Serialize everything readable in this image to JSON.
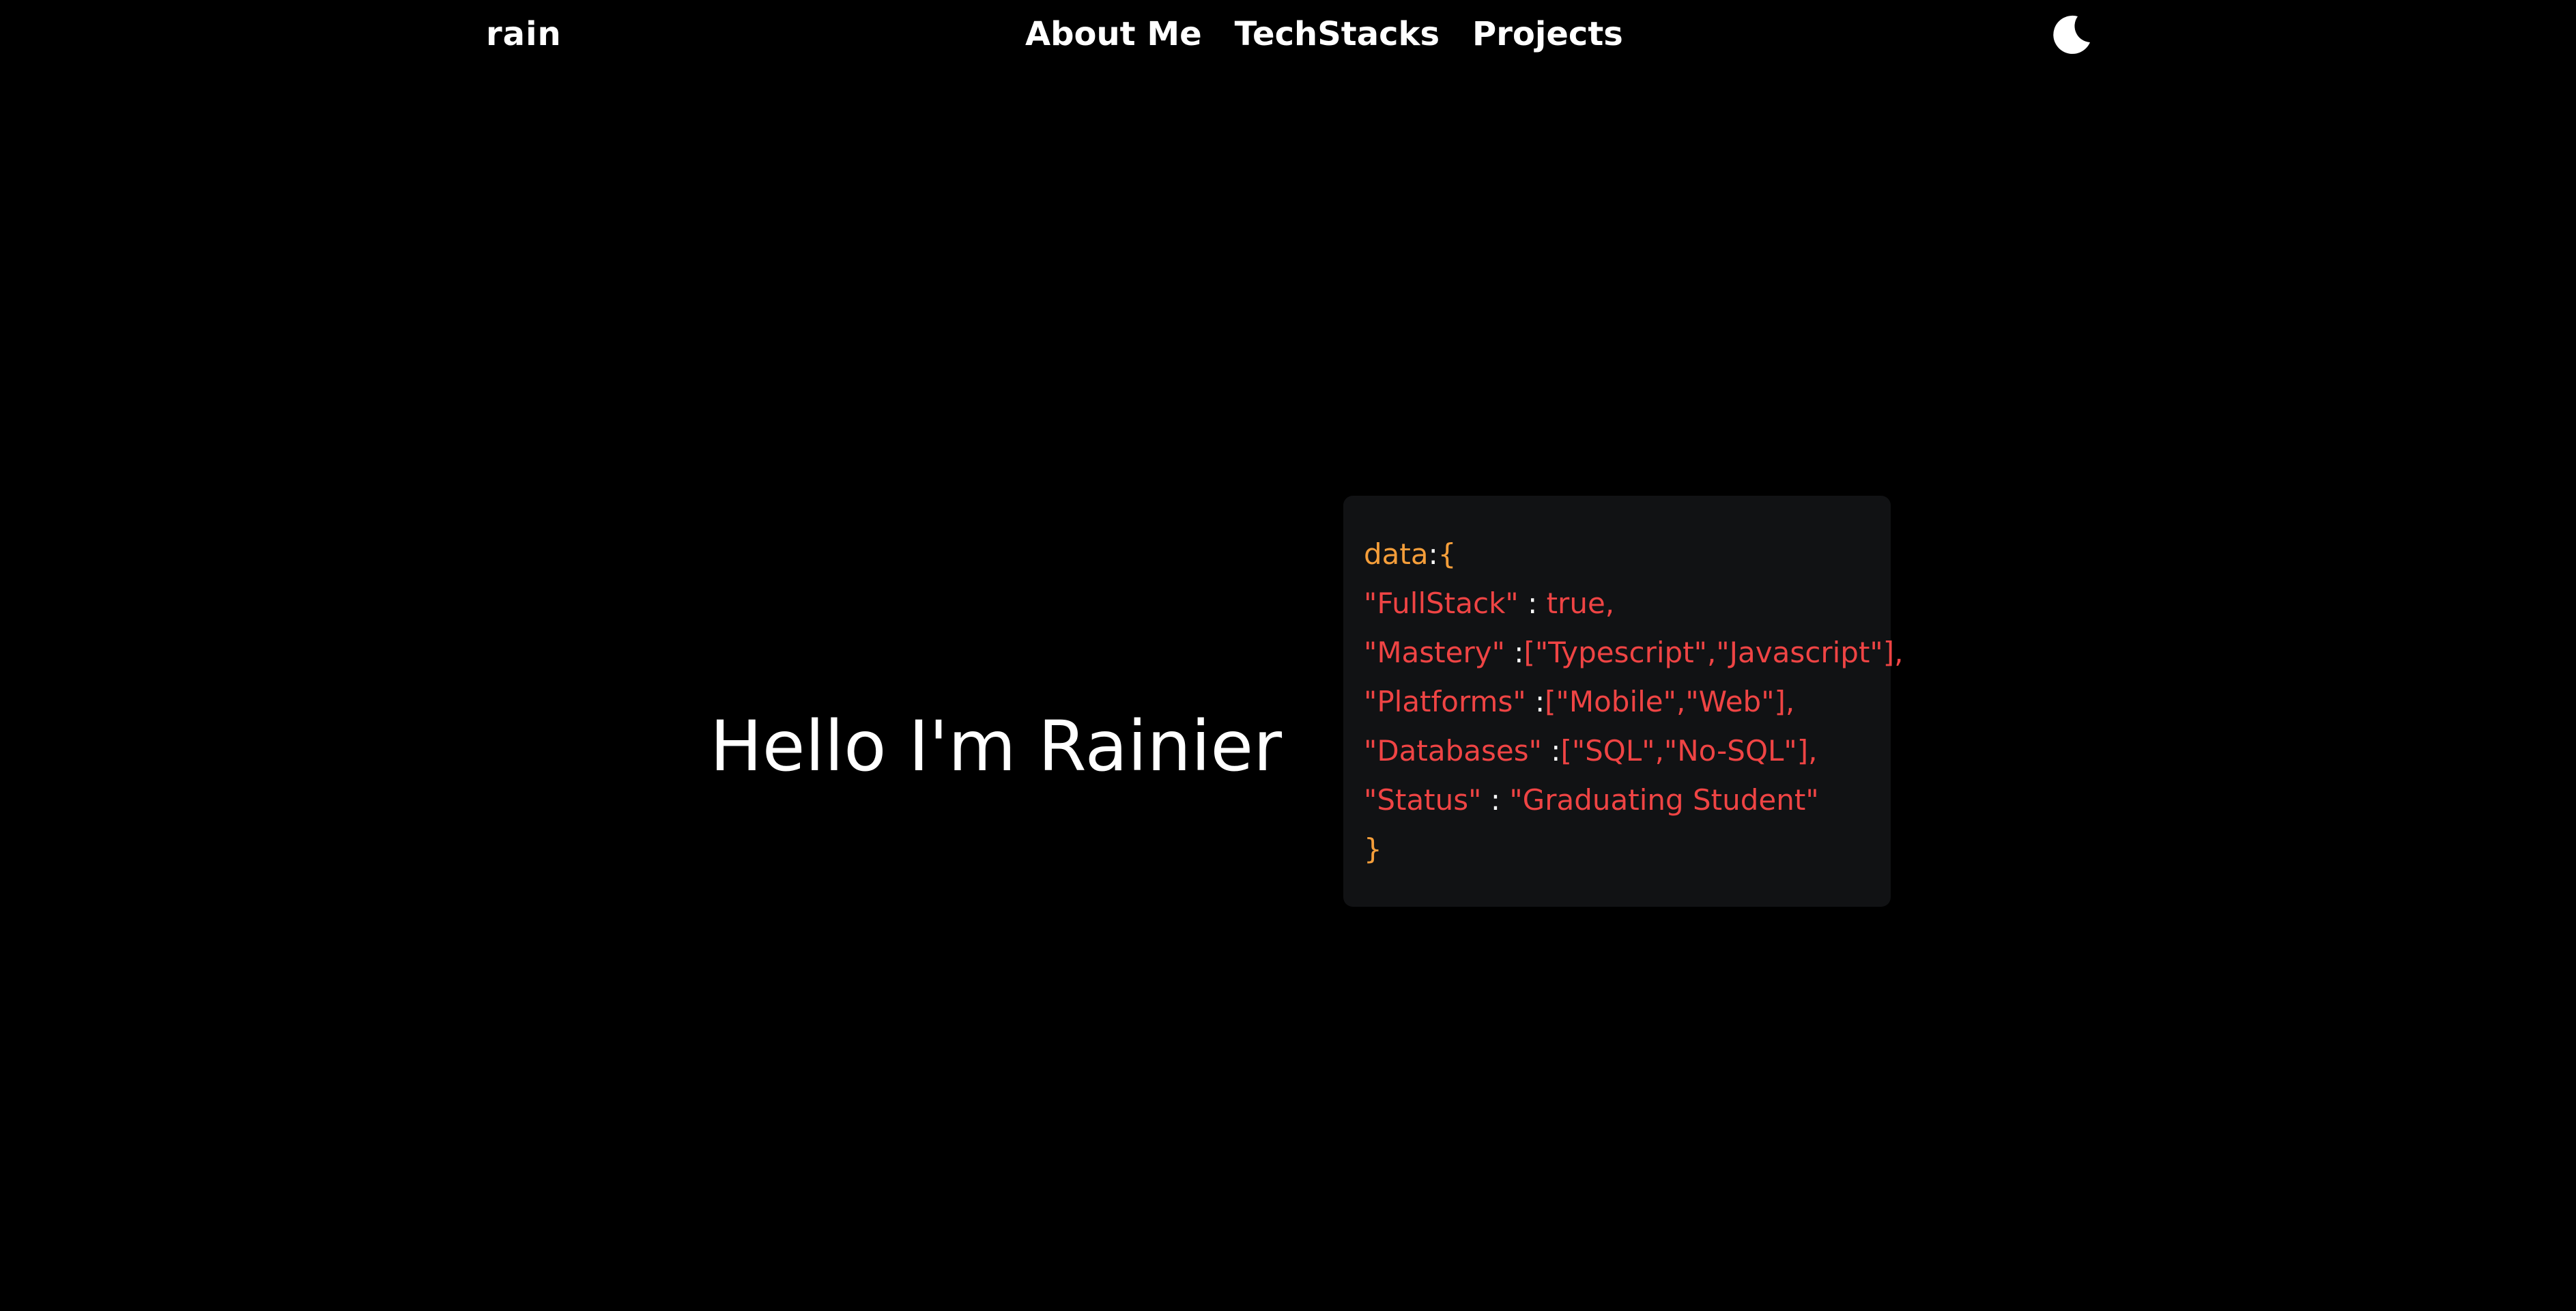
{
  "nav": {
    "brand": "rain",
    "links": [
      {
        "label": "About Me"
      },
      {
        "label": "TechStacks"
      },
      {
        "label": "Projects"
      }
    ],
    "theme_icon": "moon-icon"
  },
  "hero": {
    "greeting": "Hello I'm Rainier"
  },
  "code": {
    "open_key": "data",
    "open_colon": ":",
    "open_brace": "{",
    "lines": [
      {
        "key": "\"FullStack\"",
        "sep": " : ",
        "value": "true,"
      },
      {
        "key": "\"Mastery\"",
        "sep": " :",
        "value": "[\"Typescript\",\"Javascript\"],"
      },
      {
        "key": "\"Platforms\"",
        "sep": " :",
        "value": "[\"Mobile\",\"Web\"],"
      },
      {
        "key": "\"Databases\"",
        "sep": " :",
        "value": "[\"SQL\",\"No-SQL\"],"
      },
      {
        "key": "\"Status\"",
        "sep": " : ",
        "value": "\"Graduating Student\""
      }
    ],
    "close_brace": "}"
  },
  "colors": {
    "background": "#000000",
    "card": "#111214",
    "accent_orange": "#f59e3a",
    "accent_red": "#ef4444",
    "text": "#ffffff"
  }
}
